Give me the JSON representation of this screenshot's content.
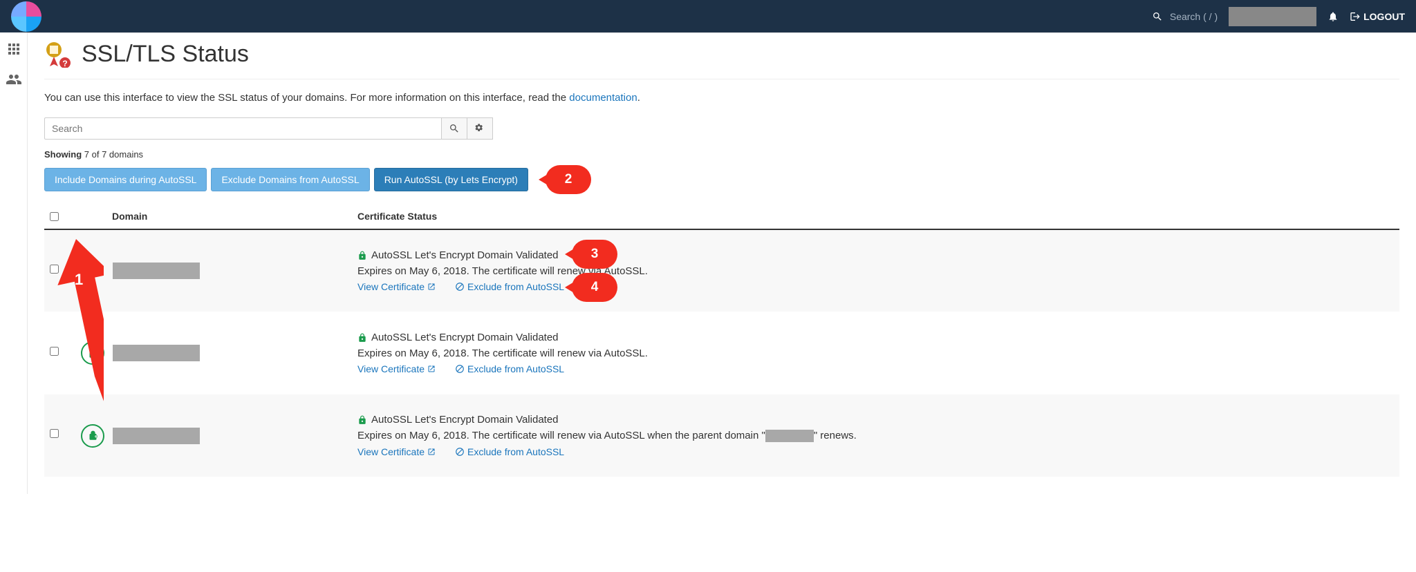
{
  "topbar": {
    "search_label": "Search ( / )",
    "logout": "LOGOUT"
  },
  "page": {
    "title": "SSL/TLS Status",
    "intro_pre": "You can use this interface to view the SSL status of your domains. For more information on this interface, read the ",
    "intro_link": "documentation",
    "intro_post": "."
  },
  "search": {
    "placeholder": "Search"
  },
  "showing": {
    "label": "Showing",
    "text": " 7 of 7 domains"
  },
  "buttons": {
    "include": "Include Domains during AutoSSL",
    "exclude": "Exclude Domains from AutoSSL",
    "run": "Run AutoSSL (by Lets Encrypt)"
  },
  "callouts": {
    "c1": "1",
    "c2": "2",
    "c3": "3",
    "c4": "4"
  },
  "table": {
    "header_domain": "Domain",
    "header_status": "Certificate Status"
  },
  "row_common": {
    "status": "AutoSSL Let's Encrypt Domain Validated",
    "view_cert": "View Certificate",
    "exclude": "Exclude from AutoSSL"
  },
  "rows": [
    {
      "expires": "Expires on May 6, 2018. The certificate will renew via AutoSSL."
    },
    {
      "expires": "Expires on May 6, 2018. The certificate will renew via AutoSSL."
    },
    {
      "expires_pre": "Expires on May 6, 2018. The certificate will renew via AutoSSL when the parent domain \"",
      "expires_post": "\" renews."
    }
  ]
}
